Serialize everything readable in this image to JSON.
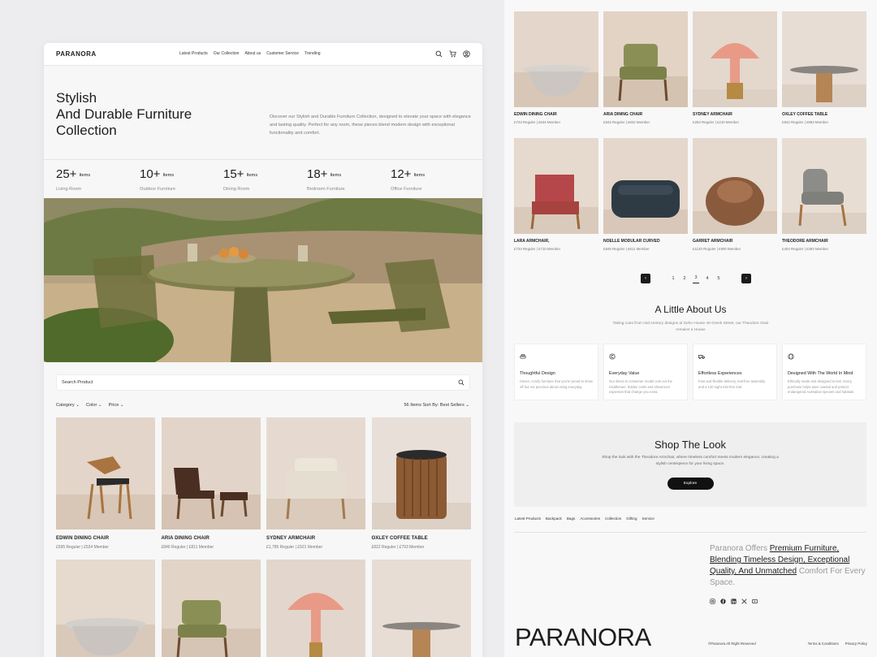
{
  "left": {
    "logo": "PARANORA",
    "nav": [
      "Latest Products",
      "Our Collection",
      "About us",
      "Customer Service",
      "Trending"
    ],
    "hero": {
      "line1": "Stylish",
      "line2": "And Durable Furniture",
      "line3": "Collection",
      "desc": "Discover our Stylish and Durable Furniture Collection, designed to elevate your space with elegance and lasting quality. Perfect for any room, these pieces blend modern design with exceptional functionality and comfort."
    },
    "stats": [
      {
        "num": "25+",
        "unit": "Items",
        "label": "Living Room"
      },
      {
        "num": "10+",
        "unit": "Items",
        "label": "Outdoor Furniture"
      },
      {
        "num": "15+",
        "unit": "Items",
        "label": "Dining Room"
      },
      {
        "num": "18+",
        "unit": "Items",
        "label": "Bedroom Furniture"
      },
      {
        "num": "12+",
        "unit": "Items",
        "label": "Office Furniture"
      }
    ],
    "search_placeholder": "Search Product",
    "filters": [
      "Category",
      "Color",
      "Price"
    ],
    "sort": "56 Items Sort By: Best Sellers",
    "products": [
      {
        "name": "EDWIN DINING CHAIR",
        "price": "£595 Reguler  |  £534 Member"
      },
      {
        "name": "ARIA DINING CHAIR",
        "price": "£846 Reguler  |  £811 Member"
      },
      {
        "name": "SYDNEY ARMCHAIR",
        "price": "£1,785 Reguler  |  £921 Member"
      },
      {
        "name": "OXLEY COFFEE TABLE",
        "price": "£822 Reguler  |  £793 Member"
      }
    ]
  },
  "right": {
    "products": [
      {
        "name": "EDWIN DINING CHAIR",
        "price": "£723 Reguler  |  £634 Member"
      },
      {
        "name": "ARIA DINING CHAIR",
        "price": "£843 Reguler  |  £822 Member"
      },
      {
        "name": "SYDNEY ARMCHAIR",
        "price": "£253 Reguler  |  £210 Member"
      },
      {
        "name": "OXLEY COFFEE TABLE",
        "price": "£942 Reguler  |  £893 Member"
      },
      {
        "name": "LARA ARMCHAIR,",
        "price": "£734 Reguler  |  £710 Member"
      },
      {
        "name": "NOELLE MODULAR CURVED",
        "price": "£846 Reguler  |  £811 Member"
      },
      {
        "name": "GARRET ARMCHAIR",
        "price": "£1120 Reguler  |  £900 Member"
      },
      {
        "name": "THEODORE ARMCHAIR",
        "price": "£404 Reguler  |  £393 Member"
      }
    ],
    "pages": [
      "1",
      "2",
      "3",
      "4",
      "5"
    ],
    "current_page": "3",
    "about": {
      "title": "A Little About Us",
      "desc": "Taking cues from mid-century designs at Soho House 40 Greek Street, our Theodore chair remains a House"
    },
    "features": [
      {
        "title": "Thoughtful Design",
        "desc": "Clever, comfy furniture that you're proud to show off but not precious about using everyday."
      },
      {
        "title": "Everyday Value",
        "desc": "Our direct to consumer model cuts out the middlemen, hidden costs and showroom expenses that change you extra."
      },
      {
        "title": "Effortless Experiences",
        "desc": "Fast and flexible delivery, tool-free assembly and a 120 night risk-free trial."
      },
      {
        "title": "Designed With The World In Mind",
        "desc": "Ethically made and designed to last. Every purchase helps save coastal and protect endangered Australian species and habitats."
      }
    ],
    "shop": {
      "title": "Shop The Look",
      "desc": "Shop the look with the Theodore Armchair, where timeless comfort meets modern elegance, creating a stylish centerpiece for your living space.",
      "button": "Explore"
    },
    "footer_links": [
      "Latest Products",
      "Backpack",
      "Bags",
      "Accessories",
      "Collection",
      "Gifting",
      "Service"
    ],
    "tagline": {
      "pre": "Paranora Offers ",
      "hl1": "Premium Furniture,",
      "hl2": "Blending Timeless Design, Exceptional",
      "hl3": "Quality, And Unmatched",
      "post": " Comfort For Every Space."
    },
    "big_logo": "PARANORA",
    "copyright": "©Paranora All Right Reserved",
    "legal": [
      "Terms & Conditions",
      "Privacy Policy"
    ]
  }
}
